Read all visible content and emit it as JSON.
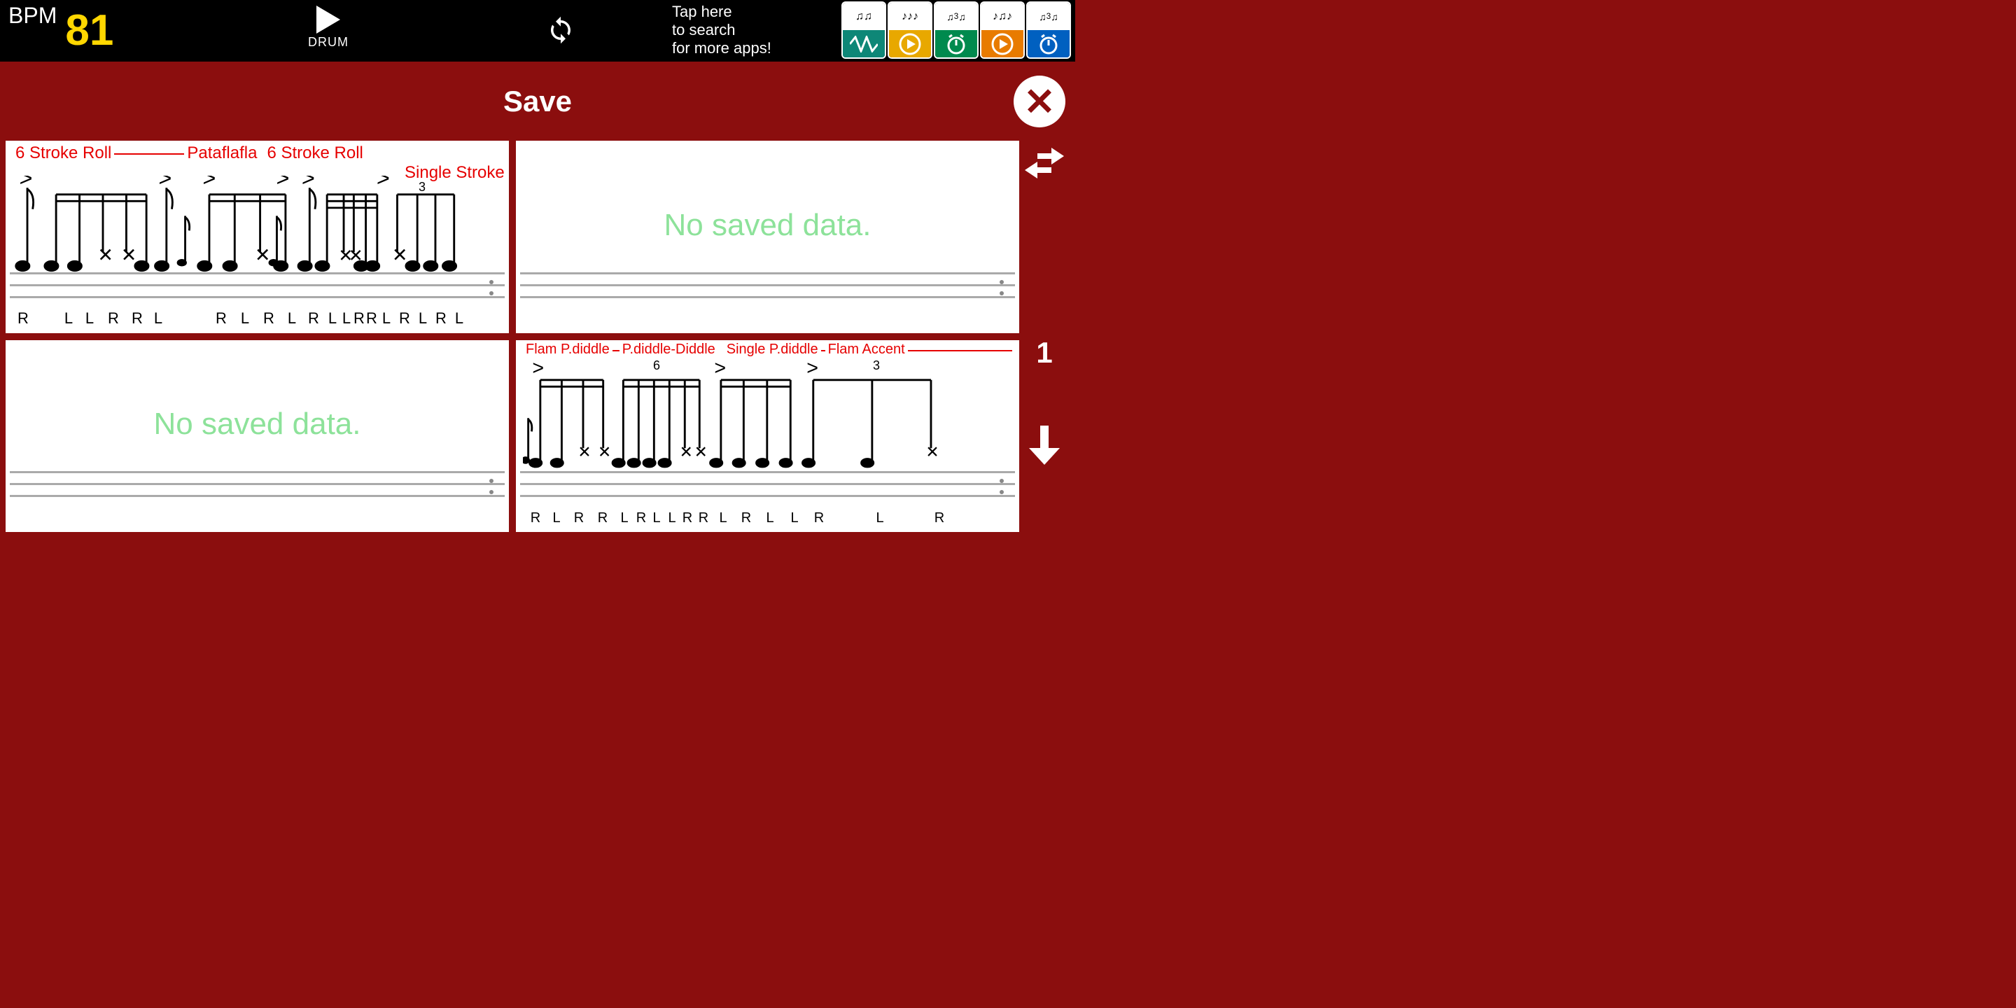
{
  "top": {
    "bpm_label": "BPM",
    "bpm_value": "81",
    "play_label": "DRUM",
    "promo": "Tap here\nto search\nfor more apps!",
    "tiles": [
      {
        "color": "#0e8777",
        "icon": "wave"
      },
      {
        "color": "#e8a800",
        "icon": "play"
      },
      {
        "color": "#008a4e",
        "icon": "clock"
      },
      {
        "color": "#e87b00",
        "icon": "play"
      },
      {
        "color": "#0060c0",
        "icon": "clock"
      }
    ]
  },
  "header": {
    "title": "Save"
  },
  "slots": [
    {
      "rudiments_line1": [
        "6 Stroke Roll",
        "Pataflafla",
        "6 Stroke Roll"
      ],
      "rudiments_line2": "Single Stroke",
      "tuplet": "3",
      "sticking": [
        "R",
        "",
        "L",
        "L",
        "R",
        "R",
        "L",
        "",
        "R",
        "L",
        "R",
        "L",
        "R",
        "L",
        "L",
        "R",
        "R",
        "L",
        "R",
        "L",
        "R",
        "L"
      ],
      "has_data": true
    },
    {
      "has_data": false,
      "empty_text": "No saved data."
    },
    {
      "has_data": false,
      "empty_text": "No saved data."
    },
    {
      "rudiments_line1": [
        "Flam P.diddle",
        "P.diddle-Diddle",
        "Single P.diddle",
        "Flam Accent"
      ],
      "tuplets": [
        "6",
        "3"
      ],
      "sticking": [
        "R",
        "L",
        "R",
        "R",
        "L",
        "R",
        "L",
        "L",
        "R",
        "R",
        "L",
        "R",
        "L",
        "L",
        "R",
        "",
        "L",
        "",
        "R"
      ],
      "has_data": true
    }
  ],
  "sidebar": {
    "page": "1"
  }
}
